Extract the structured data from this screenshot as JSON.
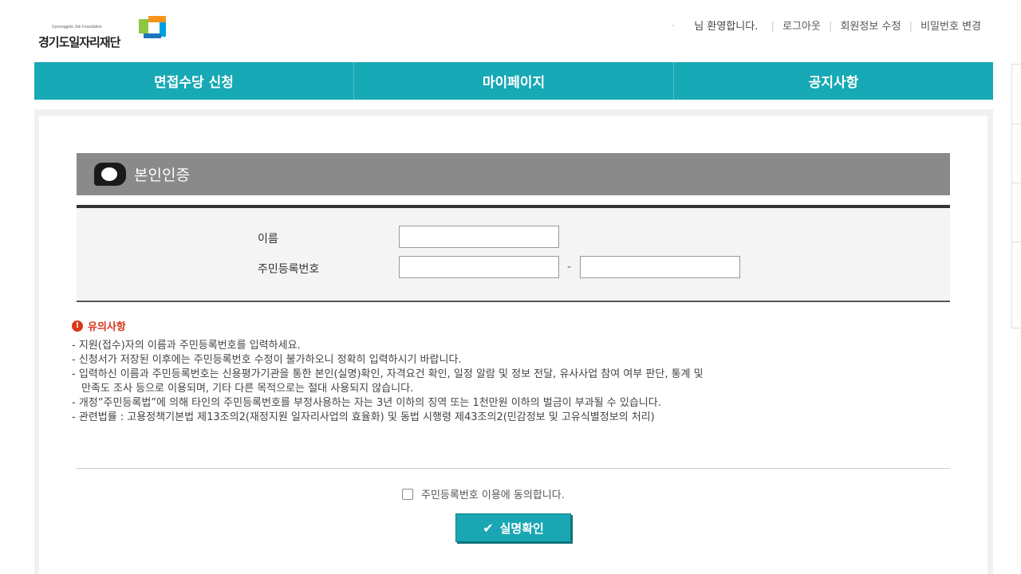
{
  "header": {
    "logo_small": "Gyeonggido Job Foundation",
    "logo_main": "경기도일자리재단",
    "welcome": "님 환영합니다.",
    "links": [
      "로그아웃",
      "회원정보 수정",
      "비밀번호 변경"
    ]
  },
  "nav": {
    "items": [
      "면접수당 신청",
      "마이페이지",
      "공지사항"
    ]
  },
  "section": {
    "title": "본인인증"
  },
  "form": {
    "name_label": "이름",
    "name_value": "",
    "rrn_label": "주민등록번호",
    "rrn_front_value": "",
    "rrn_separator": "-",
    "rrn_back_value": ""
  },
  "notice": {
    "title": "유의사항",
    "lines": [
      "- 지원(접수)자의 이름과 주민등록번호를 입력하세요.",
      "- 신청서가 저장된 이후에는 주민등록번호 수정이 불가하오니 정확히 입력하시기 바랍니다.",
      "- 입력하신 이름과 주민등록번호는 신용평가기관을 통한 본인(실명)확인, 자격요건 확인, 일정 알람 및 정보 전달, 유사사업 참여 여부 판단, 통계 및",
      "만족도 조사 등으로 이용되며, 기타 다른 목적으로는 절대 사용되지 않습니다.",
      "- 개정”주민등록법”에 의해 타인의 주민등록번호를 부정사용하는 자는 3년 이하의 징역 또는 1천만원 이하의 벌금이 부과될 수 있습니다.",
      "- 관련법률 : 고용정책기본법 제13조의2(재정지원 일자리사업의 효율화) 및 동법 시행령 제43조의2(민감정보 및 고유식별정보의 처리)"
    ]
  },
  "agree": {
    "label": "주민등록번호 이용에 동의합니다.",
    "checked": false
  },
  "confirm_button": {
    "label": "실명확인"
  },
  "colors": {
    "nav_bg": "#17a9b5",
    "section_bar": "#8a8a8a",
    "notice_red": "#d9361a",
    "button_bg": "#1aa6b3"
  }
}
